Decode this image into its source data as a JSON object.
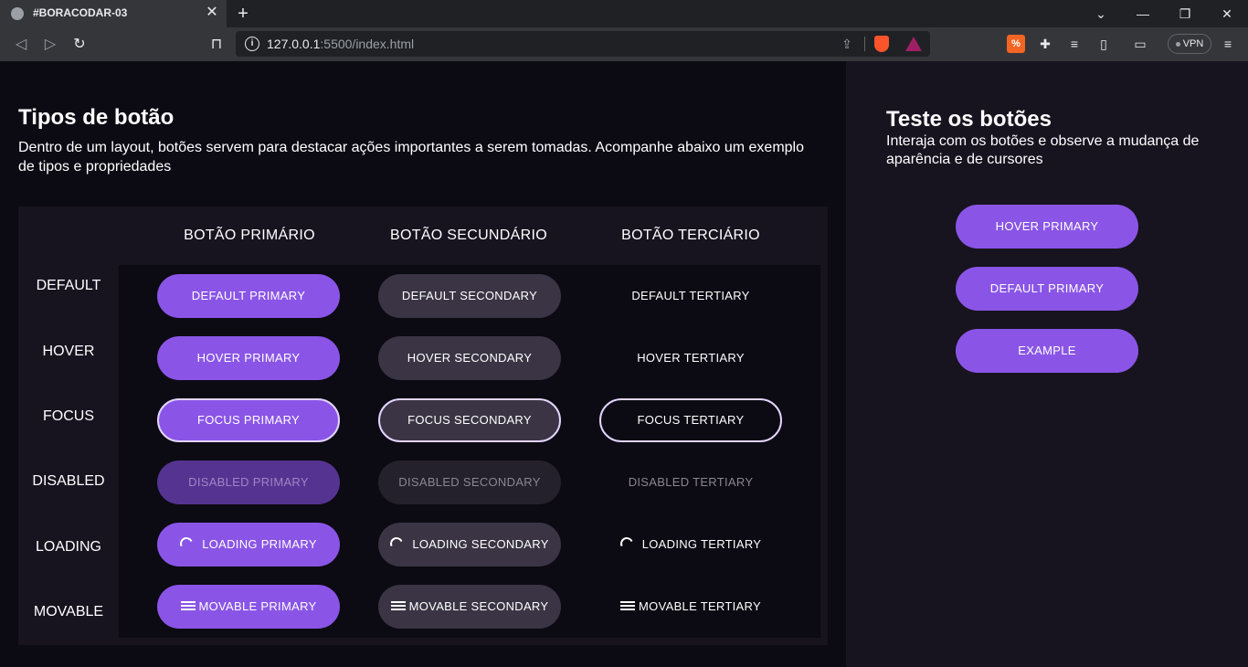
{
  "browser": {
    "tab_title": "#BORACODAR-03",
    "tab_close": "✕",
    "new_tab": "+",
    "url_host": "127.0.0.1",
    "url_path": ":5500/index.html",
    "vpn_label": "VPN",
    "window_controls": {
      "collapse": "⌄",
      "minimize": "—",
      "restore": "❐",
      "close": "✕"
    }
  },
  "page": {
    "title": "Tipos de botão",
    "lead": "Dentro de um layout, botões servem para destacar ações importantes a serem tomadas. Acompanhe abaixo um exemplo de tipos e propriedades",
    "columns": [
      "BOTÃO PRIMÁRIO",
      "BOTÃO SECUNDÁRIO",
      "BOTÃO TERCIÁRIO"
    ],
    "rows": [
      {
        "label": "DEFAULT",
        "primary": "DEFAULT PRIMARY",
        "secondary": "DEFAULT SECONDARY",
        "tertiary": "DEFAULT TERTIARY"
      },
      {
        "label": "HOVER",
        "primary": "HOVER PRIMARY",
        "secondary": "HOVER SECONDARY",
        "tertiary": "HOVER TERTIARY"
      },
      {
        "label": "FOCUS",
        "primary": "FOCUS PRIMARY",
        "secondary": "FOCUS SECONDARY",
        "tertiary": "FOCUS TERTIARY"
      },
      {
        "label": "DISABLED",
        "primary": "DISABLED PRIMARY",
        "secondary": "DISABLED SECONDARY",
        "tertiary": "DISABLED TERTIARY"
      },
      {
        "label": "LOADING",
        "primary": "LOADING PRIMARY",
        "secondary": "LOADING SECONDARY",
        "tertiary": "LOADING TERTIARY"
      },
      {
        "label": "MOVABLE",
        "primary": "MOVABLE PRIMARY",
        "secondary": "MOVABLE SECONDARY",
        "tertiary": "MOVABLE TERTIARY"
      }
    ]
  },
  "test_panel": {
    "title": "Teste os botões",
    "lead": "Interaja com os botões e observe a mudança de aparência e de cursores",
    "buttons": [
      "HOVER PRIMARY",
      "DEFAULT PRIMARY",
      "EXAMPLE"
    ]
  },
  "colors": {
    "primary": "#8a55e6",
    "secondary": "#3a3444",
    "page_bg": "#0c0a13",
    "panel_bg": "#17131f",
    "focus_ring": "#e3d4ff"
  }
}
